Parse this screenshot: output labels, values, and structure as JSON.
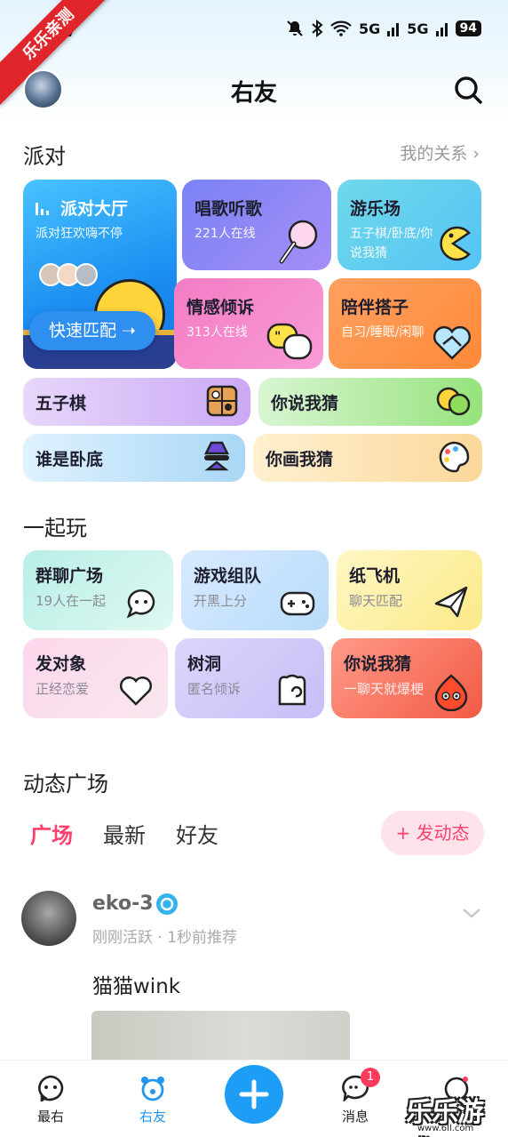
{
  "status_bar": {
    "time": "07",
    "signal_1": "5G",
    "signal_2": "5G",
    "battery": "94"
  },
  "ribbon": {
    "text": "乐乐亲测"
  },
  "header": {
    "title": "右友"
  },
  "party": {
    "title": "派对",
    "link": "我的关系 ›",
    "hall": {
      "title": "派对大厅",
      "subtitle": "派对狂欢嗨不停",
      "button": "快速匹配"
    },
    "sing": {
      "title": "唱歌听歌",
      "subtitle": "221人在线"
    },
    "fun": {
      "title": "游乐场",
      "subtitle": "五子棋/卧底/你说我猜"
    },
    "emotion": {
      "title": "情感倾诉",
      "subtitle": "313人在线"
    },
    "companion": {
      "title": "陪伴搭子",
      "subtitle": "自习/睡眠/闲聊"
    },
    "gomoku": {
      "title": "五子棋"
    },
    "guess": {
      "title": "你说我猜"
    },
    "spy": {
      "title": "谁是卧底"
    },
    "draw": {
      "title": "你画我猜"
    }
  },
  "play": {
    "title": "一起玩",
    "items": [
      {
        "title": "群聊广场",
        "subtitle": "19人在一起"
      },
      {
        "title": "游戏组队",
        "subtitle": "开黑上分"
      },
      {
        "title": "纸飞机",
        "subtitle": "聊天匹配"
      },
      {
        "title": "发对象",
        "subtitle": "正经恋爱"
      },
      {
        "title": "树洞",
        "subtitle": "匿名倾诉"
      },
      {
        "title": "你说我猜",
        "subtitle": "一聊天就爆梗"
      }
    ]
  },
  "feed": {
    "title": "动态广场",
    "tabs": [
      "广场",
      "最新",
      "好友"
    ],
    "post_button": "+ 发动态",
    "post": {
      "name": "eko-3",
      "meta": "刚刚活跃 · 1秒前推荐",
      "text": "猫猫wink"
    }
  },
  "nav": {
    "items": [
      {
        "label": "最右"
      },
      {
        "label": "右友"
      },
      {
        "label": "消息",
        "badge": "1"
      },
      {
        "label": ""
      }
    ]
  },
  "watermark": {
    "text": "乐乐游戏",
    "url": "www.6ll.com"
  },
  "colors": {
    "accent_blue": "#2396f0",
    "accent_pink": "#ff3f6c"
  }
}
